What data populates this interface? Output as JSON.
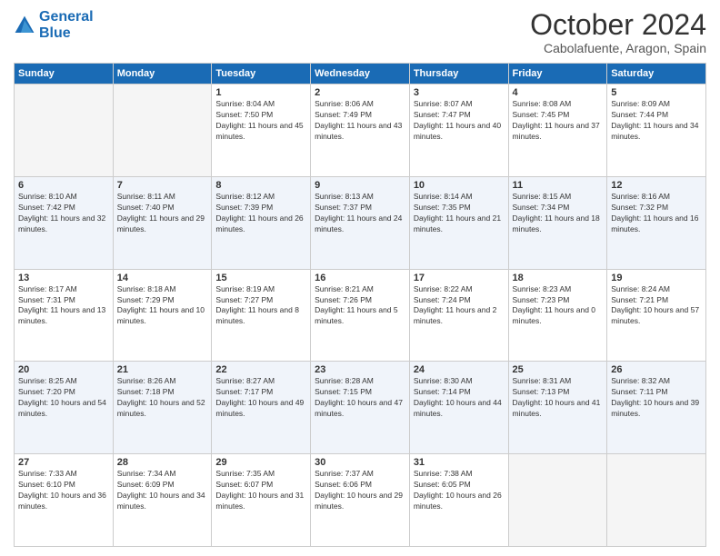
{
  "logo": {
    "line1": "General",
    "line2": "Blue"
  },
  "header": {
    "month": "October 2024",
    "location": "Cabolafuente, Aragon, Spain"
  },
  "weekdays": [
    "Sunday",
    "Monday",
    "Tuesday",
    "Wednesday",
    "Thursday",
    "Friday",
    "Saturday"
  ],
  "weeks": [
    [
      {
        "day": "",
        "sunrise": "",
        "sunset": "",
        "daylight": ""
      },
      {
        "day": "",
        "sunrise": "",
        "sunset": "",
        "daylight": ""
      },
      {
        "day": "1",
        "sunrise": "Sunrise: 8:04 AM",
        "sunset": "Sunset: 7:50 PM",
        "daylight": "Daylight: 11 hours and 45 minutes."
      },
      {
        "day": "2",
        "sunrise": "Sunrise: 8:06 AM",
        "sunset": "Sunset: 7:49 PM",
        "daylight": "Daylight: 11 hours and 43 minutes."
      },
      {
        "day": "3",
        "sunrise": "Sunrise: 8:07 AM",
        "sunset": "Sunset: 7:47 PM",
        "daylight": "Daylight: 11 hours and 40 minutes."
      },
      {
        "day": "4",
        "sunrise": "Sunrise: 8:08 AM",
        "sunset": "Sunset: 7:45 PM",
        "daylight": "Daylight: 11 hours and 37 minutes."
      },
      {
        "day": "5",
        "sunrise": "Sunrise: 8:09 AM",
        "sunset": "Sunset: 7:44 PM",
        "daylight": "Daylight: 11 hours and 34 minutes."
      }
    ],
    [
      {
        "day": "6",
        "sunrise": "Sunrise: 8:10 AM",
        "sunset": "Sunset: 7:42 PM",
        "daylight": "Daylight: 11 hours and 32 minutes."
      },
      {
        "day": "7",
        "sunrise": "Sunrise: 8:11 AM",
        "sunset": "Sunset: 7:40 PM",
        "daylight": "Daylight: 11 hours and 29 minutes."
      },
      {
        "day": "8",
        "sunrise": "Sunrise: 8:12 AM",
        "sunset": "Sunset: 7:39 PM",
        "daylight": "Daylight: 11 hours and 26 minutes."
      },
      {
        "day": "9",
        "sunrise": "Sunrise: 8:13 AM",
        "sunset": "Sunset: 7:37 PM",
        "daylight": "Daylight: 11 hours and 24 minutes."
      },
      {
        "day": "10",
        "sunrise": "Sunrise: 8:14 AM",
        "sunset": "Sunset: 7:35 PM",
        "daylight": "Daylight: 11 hours and 21 minutes."
      },
      {
        "day": "11",
        "sunrise": "Sunrise: 8:15 AM",
        "sunset": "Sunset: 7:34 PM",
        "daylight": "Daylight: 11 hours and 18 minutes."
      },
      {
        "day": "12",
        "sunrise": "Sunrise: 8:16 AM",
        "sunset": "Sunset: 7:32 PM",
        "daylight": "Daylight: 11 hours and 16 minutes."
      }
    ],
    [
      {
        "day": "13",
        "sunrise": "Sunrise: 8:17 AM",
        "sunset": "Sunset: 7:31 PM",
        "daylight": "Daylight: 11 hours and 13 minutes."
      },
      {
        "day": "14",
        "sunrise": "Sunrise: 8:18 AM",
        "sunset": "Sunset: 7:29 PM",
        "daylight": "Daylight: 11 hours and 10 minutes."
      },
      {
        "day": "15",
        "sunrise": "Sunrise: 8:19 AM",
        "sunset": "Sunset: 7:27 PM",
        "daylight": "Daylight: 11 hours and 8 minutes."
      },
      {
        "day": "16",
        "sunrise": "Sunrise: 8:21 AM",
        "sunset": "Sunset: 7:26 PM",
        "daylight": "Daylight: 11 hours and 5 minutes."
      },
      {
        "day": "17",
        "sunrise": "Sunrise: 8:22 AM",
        "sunset": "Sunset: 7:24 PM",
        "daylight": "Daylight: 11 hours and 2 minutes."
      },
      {
        "day": "18",
        "sunrise": "Sunrise: 8:23 AM",
        "sunset": "Sunset: 7:23 PM",
        "daylight": "Daylight: 11 hours and 0 minutes."
      },
      {
        "day": "19",
        "sunrise": "Sunrise: 8:24 AM",
        "sunset": "Sunset: 7:21 PM",
        "daylight": "Daylight: 10 hours and 57 minutes."
      }
    ],
    [
      {
        "day": "20",
        "sunrise": "Sunrise: 8:25 AM",
        "sunset": "Sunset: 7:20 PM",
        "daylight": "Daylight: 10 hours and 54 minutes."
      },
      {
        "day": "21",
        "sunrise": "Sunrise: 8:26 AM",
        "sunset": "Sunset: 7:18 PM",
        "daylight": "Daylight: 10 hours and 52 minutes."
      },
      {
        "day": "22",
        "sunrise": "Sunrise: 8:27 AM",
        "sunset": "Sunset: 7:17 PM",
        "daylight": "Daylight: 10 hours and 49 minutes."
      },
      {
        "day": "23",
        "sunrise": "Sunrise: 8:28 AM",
        "sunset": "Sunset: 7:15 PM",
        "daylight": "Daylight: 10 hours and 47 minutes."
      },
      {
        "day": "24",
        "sunrise": "Sunrise: 8:30 AM",
        "sunset": "Sunset: 7:14 PM",
        "daylight": "Daylight: 10 hours and 44 minutes."
      },
      {
        "day": "25",
        "sunrise": "Sunrise: 8:31 AM",
        "sunset": "Sunset: 7:13 PM",
        "daylight": "Daylight: 10 hours and 41 minutes."
      },
      {
        "day": "26",
        "sunrise": "Sunrise: 8:32 AM",
        "sunset": "Sunset: 7:11 PM",
        "daylight": "Daylight: 10 hours and 39 minutes."
      }
    ],
    [
      {
        "day": "27",
        "sunrise": "Sunrise: 7:33 AM",
        "sunset": "Sunset: 6:10 PM",
        "daylight": "Daylight: 10 hours and 36 minutes."
      },
      {
        "day": "28",
        "sunrise": "Sunrise: 7:34 AM",
        "sunset": "Sunset: 6:09 PM",
        "daylight": "Daylight: 10 hours and 34 minutes."
      },
      {
        "day": "29",
        "sunrise": "Sunrise: 7:35 AM",
        "sunset": "Sunset: 6:07 PM",
        "daylight": "Daylight: 10 hours and 31 minutes."
      },
      {
        "day": "30",
        "sunrise": "Sunrise: 7:37 AM",
        "sunset": "Sunset: 6:06 PM",
        "daylight": "Daylight: 10 hours and 29 minutes."
      },
      {
        "day": "31",
        "sunrise": "Sunrise: 7:38 AM",
        "sunset": "Sunset: 6:05 PM",
        "daylight": "Daylight: 10 hours and 26 minutes."
      },
      {
        "day": "",
        "sunrise": "",
        "sunset": "",
        "daylight": ""
      },
      {
        "day": "",
        "sunrise": "",
        "sunset": "",
        "daylight": ""
      }
    ]
  ]
}
